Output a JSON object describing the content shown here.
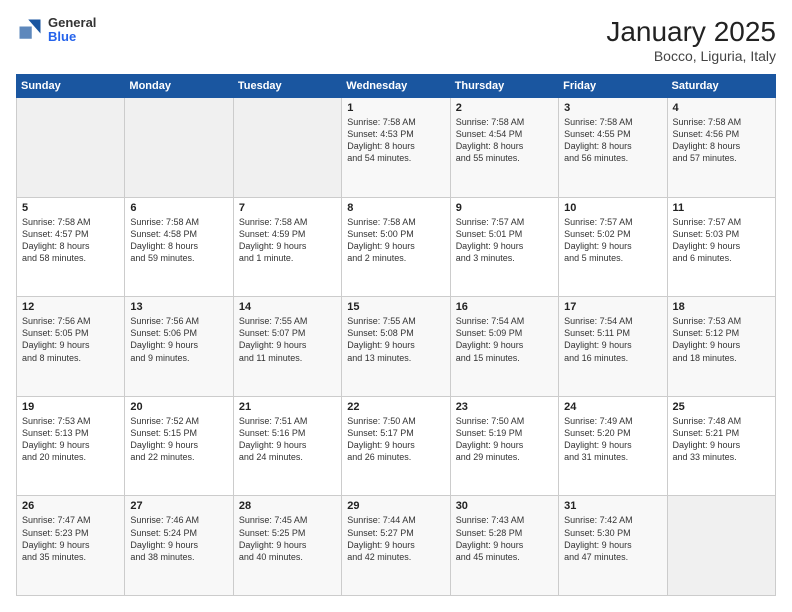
{
  "header": {
    "logo_general": "General",
    "logo_blue": "Blue",
    "title": "January 2025",
    "subtitle": "Bocco, Liguria, Italy"
  },
  "columns": [
    "Sunday",
    "Monday",
    "Tuesday",
    "Wednesday",
    "Thursday",
    "Friday",
    "Saturday"
  ],
  "weeks": [
    [
      {
        "day": "",
        "text": ""
      },
      {
        "day": "",
        "text": ""
      },
      {
        "day": "",
        "text": ""
      },
      {
        "day": "1",
        "text": "Sunrise: 7:58 AM\nSunset: 4:53 PM\nDaylight: 8 hours\nand 54 minutes."
      },
      {
        "day": "2",
        "text": "Sunrise: 7:58 AM\nSunset: 4:54 PM\nDaylight: 8 hours\nand 55 minutes."
      },
      {
        "day": "3",
        "text": "Sunrise: 7:58 AM\nSunset: 4:55 PM\nDaylight: 8 hours\nand 56 minutes."
      },
      {
        "day": "4",
        "text": "Sunrise: 7:58 AM\nSunset: 4:56 PM\nDaylight: 8 hours\nand 57 minutes."
      }
    ],
    [
      {
        "day": "5",
        "text": "Sunrise: 7:58 AM\nSunset: 4:57 PM\nDaylight: 8 hours\nand 58 minutes."
      },
      {
        "day": "6",
        "text": "Sunrise: 7:58 AM\nSunset: 4:58 PM\nDaylight: 8 hours\nand 59 minutes."
      },
      {
        "day": "7",
        "text": "Sunrise: 7:58 AM\nSunset: 4:59 PM\nDaylight: 9 hours\nand 1 minute."
      },
      {
        "day": "8",
        "text": "Sunrise: 7:58 AM\nSunset: 5:00 PM\nDaylight: 9 hours\nand 2 minutes."
      },
      {
        "day": "9",
        "text": "Sunrise: 7:57 AM\nSunset: 5:01 PM\nDaylight: 9 hours\nand 3 minutes."
      },
      {
        "day": "10",
        "text": "Sunrise: 7:57 AM\nSunset: 5:02 PM\nDaylight: 9 hours\nand 5 minutes."
      },
      {
        "day": "11",
        "text": "Sunrise: 7:57 AM\nSunset: 5:03 PM\nDaylight: 9 hours\nand 6 minutes."
      }
    ],
    [
      {
        "day": "12",
        "text": "Sunrise: 7:56 AM\nSunset: 5:05 PM\nDaylight: 9 hours\nand 8 minutes."
      },
      {
        "day": "13",
        "text": "Sunrise: 7:56 AM\nSunset: 5:06 PM\nDaylight: 9 hours\nand 9 minutes."
      },
      {
        "day": "14",
        "text": "Sunrise: 7:55 AM\nSunset: 5:07 PM\nDaylight: 9 hours\nand 11 minutes."
      },
      {
        "day": "15",
        "text": "Sunrise: 7:55 AM\nSunset: 5:08 PM\nDaylight: 9 hours\nand 13 minutes."
      },
      {
        "day": "16",
        "text": "Sunrise: 7:54 AM\nSunset: 5:09 PM\nDaylight: 9 hours\nand 15 minutes."
      },
      {
        "day": "17",
        "text": "Sunrise: 7:54 AM\nSunset: 5:11 PM\nDaylight: 9 hours\nand 16 minutes."
      },
      {
        "day": "18",
        "text": "Sunrise: 7:53 AM\nSunset: 5:12 PM\nDaylight: 9 hours\nand 18 minutes."
      }
    ],
    [
      {
        "day": "19",
        "text": "Sunrise: 7:53 AM\nSunset: 5:13 PM\nDaylight: 9 hours\nand 20 minutes."
      },
      {
        "day": "20",
        "text": "Sunrise: 7:52 AM\nSunset: 5:15 PM\nDaylight: 9 hours\nand 22 minutes."
      },
      {
        "day": "21",
        "text": "Sunrise: 7:51 AM\nSunset: 5:16 PM\nDaylight: 9 hours\nand 24 minutes."
      },
      {
        "day": "22",
        "text": "Sunrise: 7:50 AM\nSunset: 5:17 PM\nDaylight: 9 hours\nand 26 minutes."
      },
      {
        "day": "23",
        "text": "Sunrise: 7:50 AM\nSunset: 5:19 PM\nDaylight: 9 hours\nand 29 minutes."
      },
      {
        "day": "24",
        "text": "Sunrise: 7:49 AM\nSunset: 5:20 PM\nDaylight: 9 hours\nand 31 minutes."
      },
      {
        "day": "25",
        "text": "Sunrise: 7:48 AM\nSunset: 5:21 PM\nDaylight: 9 hours\nand 33 minutes."
      }
    ],
    [
      {
        "day": "26",
        "text": "Sunrise: 7:47 AM\nSunset: 5:23 PM\nDaylight: 9 hours\nand 35 minutes."
      },
      {
        "day": "27",
        "text": "Sunrise: 7:46 AM\nSunset: 5:24 PM\nDaylight: 9 hours\nand 38 minutes."
      },
      {
        "day": "28",
        "text": "Sunrise: 7:45 AM\nSunset: 5:25 PM\nDaylight: 9 hours\nand 40 minutes."
      },
      {
        "day": "29",
        "text": "Sunrise: 7:44 AM\nSunset: 5:27 PM\nDaylight: 9 hours\nand 42 minutes."
      },
      {
        "day": "30",
        "text": "Sunrise: 7:43 AM\nSunset: 5:28 PM\nDaylight: 9 hours\nand 45 minutes."
      },
      {
        "day": "31",
        "text": "Sunrise: 7:42 AM\nSunset: 5:30 PM\nDaylight: 9 hours\nand 47 minutes."
      },
      {
        "day": "",
        "text": ""
      }
    ]
  ]
}
